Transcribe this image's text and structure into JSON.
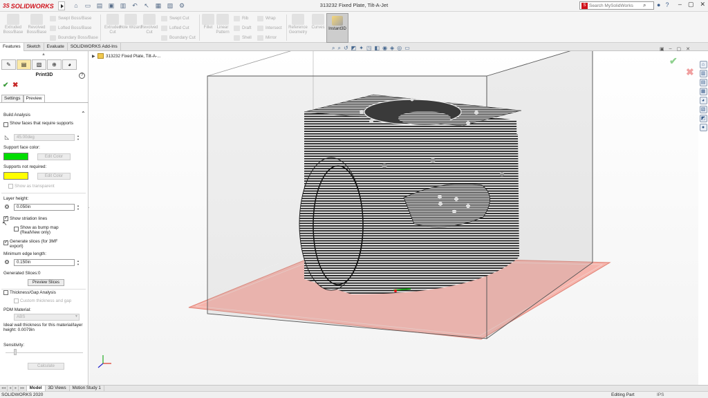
{
  "app": {
    "logo_text": "SOLIDWORKS",
    "logo_mark": "3S",
    "document_title": "313232 Fixed Plate, Tilt-A-Jet",
    "search_placeholder": "Search MySolidWorks"
  },
  "ribbon": {
    "big_buttons": [
      {
        "label": "Extruded Boss/Base"
      },
      {
        "label": "Revolved Boss/Base"
      },
      {
        "label": "Extruded Cut"
      },
      {
        "label": "Hole Wizard"
      },
      {
        "label": "Revolved Cut"
      },
      {
        "label": "Fillet"
      },
      {
        "label": "Linear Pattern"
      },
      {
        "label": "Reference Geometry"
      },
      {
        "label": "Curves"
      }
    ],
    "small_buttons": [
      {
        "label": "Swept Boss/Base"
      },
      {
        "label": "Lofted Boss/Base"
      },
      {
        "label": "Boundary Boss/Base"
      },
      {
        "label": "Swept Cut"
      },
      {
        "label": "Lofted Cut"
      },
      {
        "label": "Boundary Cut"
      },
      {
        "label": "Rib"
      },
      {
        "label": "Draft"
      },
      {
        "label": "Shell"
      },
      {
        "label": "Wrap"
      },
      {
        "label": "Intersect"
      },
      {
        "label": "Mirror"
      }
    ],
    "instant3d_label": "Instant3D"
  },
  "tabs": [
    "Features",
    "Sketch",
    "Evaluate",
    "SOLIDWORKS Add-Ins"
  ],
  "property_manager": {
    "title": "Print3D",
    "subtabs": [
      "Settings",
      "Preview"
    ],
    "build_analysis": {
      "header": "Build Analysis",
      "show_faces_label": "Show faces that require supports",
      "show_faces_checked": false,
      "angle_value": "45.00deg",
      "support_face_color_label": "Support face color:",
      "support_face_color": "#00dd00",
      "edit_color_label": "Edit Color",
      "supports_not_required_label": "Supports not required:",
      "supports_not_required_color": "#ffff00",
      "show_transparent_label": "Show as transparent"
    },
    "layer": {
      "layer_height_label": "Layer height:",
      "layer_height_value": "0.050in",
      "show_striation_label": "Show striation lines",
      "show_striation_checked": true,
      "show_bump_label": "Show as bump map (RealView only)",
      "show_bump_checked": false,
      "generate_slices_label": "Generate slices (for 3MF export)",
      "generate_slices_checked": true,
      "min_edge_label": "Minimum edge length:",
      "min_edge_value": "0.150in",
      "generated_slices_label": "Generated Slices:",
      "generated_slices_value": "0",
      "preview_slices_label": "Preview Slices"
    },
    "thickness": {
      "label": "Thickness/Gap Analysis",
      "checked": false,
      "custom_label": "Custom thickness and gap",
      "pdm_label": "PDM Material:",
      "pdm_value": "ABS",
      "ideal_wall_label": "Ideal wall thickness for this material/layer height: 0.0079in",
      "sensitivity_label": "Sensitivity:",
      "calculate_label": "Calculate"
    }
  },
  "feature_tree": {
    "part_name": "313232 Fixed Plate, Tilt-A-..."
  },
  "bottom_tabs": [
    "Model",
    "3D Views",
    "Motion Study 1"
  ],
  "status": {
    "app_version": "SOLIDWORKS 2020",
    "mode": "Editing Part",
    "units": "IPS"
  },
  "colors": {
    "brand_red": "#d0121b",
    "build_plate": "#f4a79f",
    "ok_green": "#3a9a3a",
    "cancel_red": "#c62828"
  }
}
